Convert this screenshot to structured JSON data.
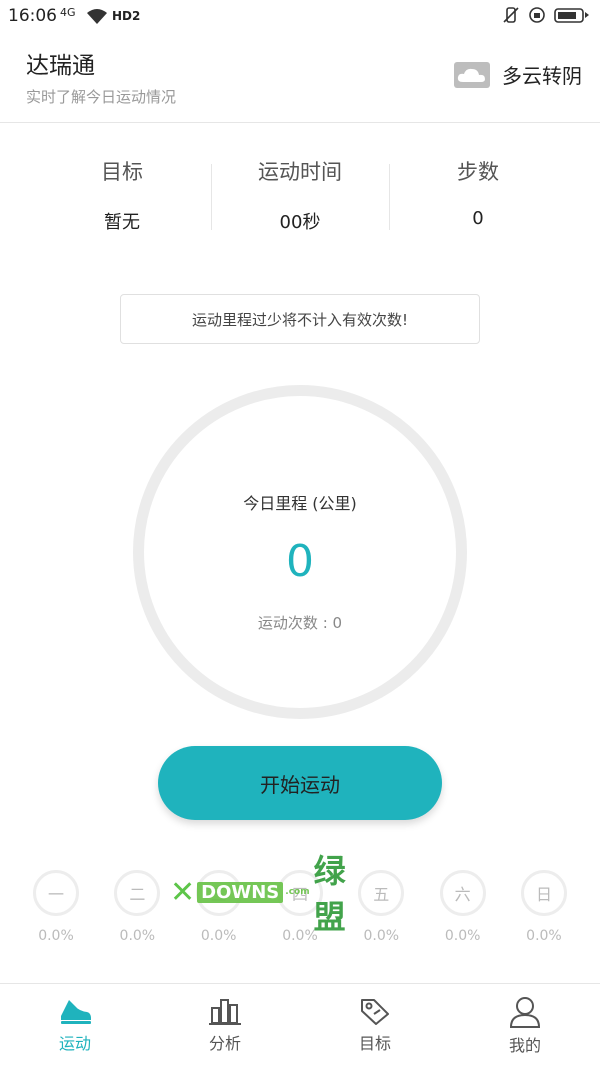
{
  "status_bar": {
    "time": "16:06",
    "signal_text": "4G",
    "hd_text": "HD2"
  },
  "header": {
    "title": "达瑞通",
    "subtitle": "实时了解今日运动情况",
    "weather": "多云转阴"
  },
  "stats": [
    {
      "label": "目标",
      "value": "暂无"
    },
    {
      "label": "运动时间",
      "value": "00秒"
    },
    {
      "label": "步数",
      "value": "0"
    }
  ],
  "notice": "运动里程过少将不计入有效次数!",
  "ring": {
    "label": "今日里程 (公里)",
    "distance": "0",
    "count_label": "运动次数 : 0"
  },
  "start_button": "开始运动",
  "week": [
    {
      "day": "一",
      "pct": "0.0%"
    },
    {
      "day": "二",
      "pct": "0.0%"
    },
    {
      "day": "三",
      "pct": "0.0%"
    },
    {
      "day": "四",
      "pct": "0.0%"
    },
    {
      "day": "五",
      "pct": "0.0%"
    },
    {
      "day": "六",
      "pct": "0.0%"
    },
    {
      "day": "日",
      "pct": "0.0%"
    }
  ],
  "watermark": {
    "brand": "DOWNS",
    "cn": "绿盟",
    "dot": ".com"
  },
  "tabs": [
    {
      "label": "运动",
      "icon": "shoe-icon"
    },
    {
      "label": "分析",
      "icon": "bar-chart-icon"
    },
    {
      "label": "目标",
      "icon": "tag-icon"
    },
    {
      "label": "我的",
      "icon": "user-icon"
    }
  ],
  "colors": {
    "accent": "#1fb3bd",
    "ring": "#ececec",
    "muted": "#bbbbbb"
  }
}
